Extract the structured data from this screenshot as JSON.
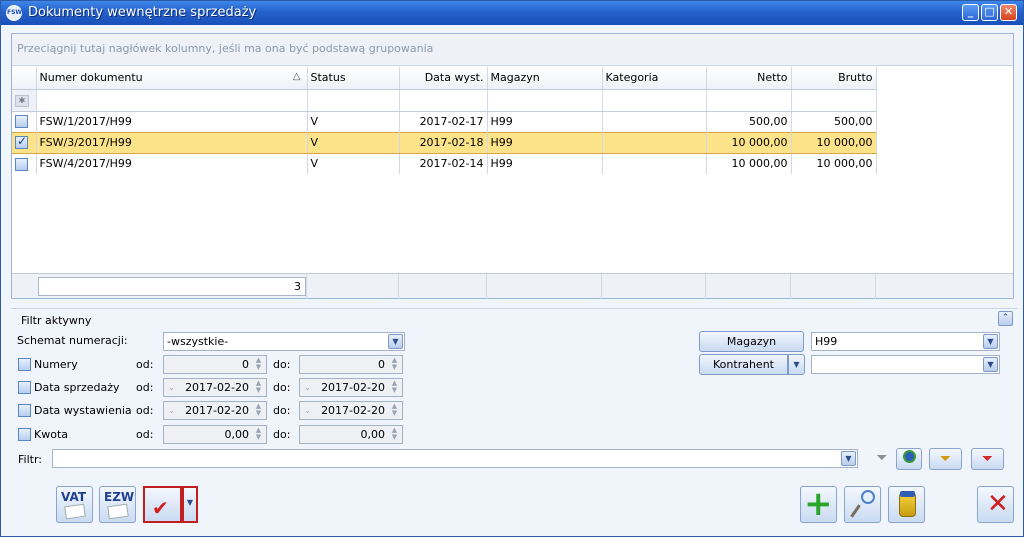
{
  "window": {
    "title": "Dokumenty wewnętrzne sprzedaży",
    "app_icon": "FSW",
    "minimize": "_",
    "maximize": "□",
    "close": "✕"
  },
  "grid": {
    "group_hint": "Przeciągnij tutaj nagłówek kolumny, jeśli ma ona być podstawą grupowania",
    "columns": [
      "Numer dokumentu",
      "Status",
      "Data wyst.",
      "Magazyn",
      "Kategoria",
      "Netto",
      "Brutto"
    ],
    "sort_indicator": "△",
    "rows": [
      {
        "checked": false,
        "numer": "FSW/1/2017/H99",
        "status": "V",
        "data": "2017-02-17",
        "magazyn": "H99",
        "kategoria": "",
        "netto": "500,00",
        "brutto": "500,00"
      },
      {
        "checked": true,
        "numer": "FSW/3/2017/H99",
        "status": "V",
        "data": "2017-02-18",
        "magazyn": "H99",
        "kategoria": "",
        "netto": "10 000,00",
        "brutto": "10 000,00"
      },
      {
        "checked": false,
        "numer": "FSW/4/2017/H99",
        "status": "V",
        "data": "2017-02-14",
        "magazyn": "H99",
        "kategoria": "",
        "netto": "10 000,00",
        "brutto": "10 000,00"
      }
    ],
    "footer_count": "3"
  },
  "filter": {
    "section_title": "Filtr aktywny",
    "schemat_label": "Schemat numeracji:",
    "schemat_value": "-wszystkie-",
    "numery_label": "Numery",
    "data_sprzedazy_label": "Data sprzedaży",
    "data_wystawienia_label": "Data wystawienia",
    "kwota_label": "Kwota",
    "od_label": "od:",
    "do_label": "do:",
    "numery_od": "0",
    "numery_do": "0",
    "sprzedaz_od": "2017-02-20",
    "sprzedaz_do": "2017-02-20",
    "wystawienie_od": "2017-02-20",
    "wystawienie_do": "2017-02-20",
    "kwota_od": "0,00",
    "kwota_do": "0,00",
    "magazyn_button": "Magazyn",
    "magazyn_value": "H99",
    "kontrahent_button": "Kontrahent",
    "kontrahent_value": "",
    "filtr_label": "Filtr:",
    "filtr_value": ""
  },
  "toolbar": {
    "vat_label": "VAT",
    "ezw_label": "EZW"
  }
}
